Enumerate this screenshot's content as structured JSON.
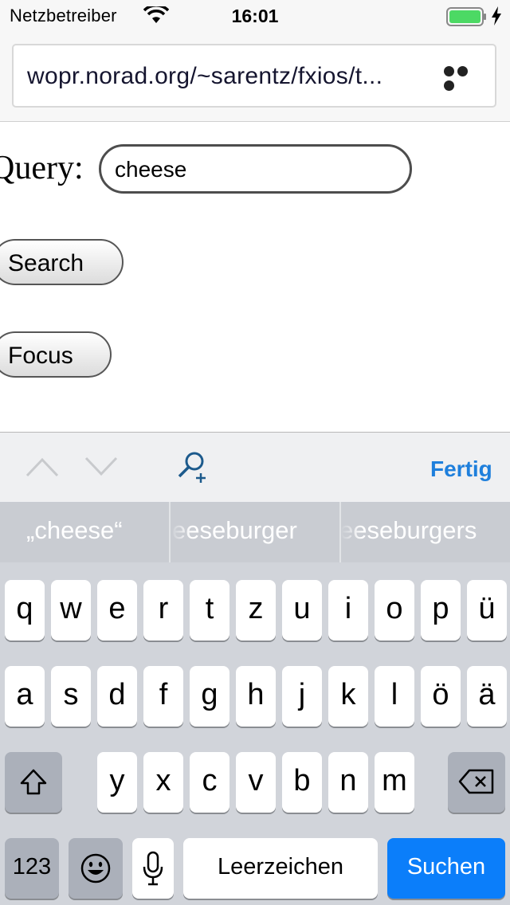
{
  "status_bar": {
    "carrier": "Netzbetreiber",
    "time": "16:01",
    "battery_level": 1.0,
    "battery_color": "#4cd964"
  },
  "browser": {
    "url": "wopr.norad.org/~sarentz/fxios/t...",
    "menu_icon": "more-dots-icon"
  },
  "page": {
    "query_label": "Query:",
    "query_value": "cheese",
    "search_button": "Search",
    "focus_button": "Focus"
  },
  "accessory_bar": {
    "previous_icon": "chevron-up-icon",
    "next_icon": "chevron-down-icon",
    "find_icon": "find-in-page-icon",
    "done_label": "Fertig",
    "done_color": "#1e7fdc"
  },
  "predictions": [
    "„cheese“",
    "eeseburger",
    "eeseburgers"
  ],
  "keyboard": {
    "row1": [
      "q",
      "w",
      "e",
      "r",
      "t",
      "z",
      "u",
      "i",
      "o",
      "p",
      "ü"
    ],
    "row2": [
      "a",
      "s",
      "d",
      "f",
      "g",
      "h",
      "j",
      "k",
      "l",
      "ö",
      "ä"
    ],
    "row3": [
      "y",
      "x",
      "c",
      "v",
      "b",
      "n",
      "m"
    ],
    "numbers_key": "123",
    "space_key": "Leerzeichen",
    "return_key": "Suchen",
    "return_color": "#0b7efa",
    "shift_icon": "shift-icon",
    "delete_icon": "backspace-icon",
    "emoji_icon": "emoji-icon",
    "mic_icon": "microphone-icon"
  }
}
